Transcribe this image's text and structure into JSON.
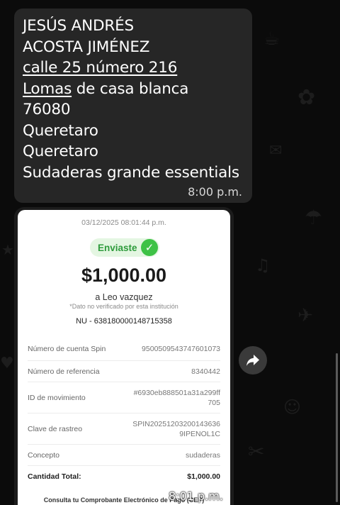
{
  "message": {
    "lines": [
      "JESÚS ANDRÉS",
      "ACOSTA JIMÉNEZ",
      "calle 25 número 216",
      "Lomas",
      " de casa blanca",
      "76080",
      "Queretaro",
      "Queretaro",
      "Sudaderas grande essentials"
    ],
    "time": "8:00 p.m."
  },
  "receipt": {
    "datetime": "03/12/2025 08:01:44 p.m.",
    "status": "Enviaste",
    "amount": "$1,000.00",
    "recipient": "a Leo vazquez",
    "unverified_note": "*Dato no verificado por esta institución",
    "account": "NU - 638180000148715358",
    "rows": [
      {
        "label": "Número de cuenta Spin",
        "value": "9500509543747601073"
      },
      {
        "label": "Número de referencia",
        "value": "8340442"
      },
      {
        "label": "ID de movimiento",
        "value1": "#6930eb888501a31a299ff",
        "value2": "705"
      },
      {
        "label": "Clave de rastreo",
        "value1": "SPIN20251203200143636",
        "value2": "9IPENOL1C"
      },
      {
        "label": "Concepto",
        "value": "sudaderas"
      },
      {
        "label": "Cantidad Total:",
        "value": "$1,000.00"
      }
    ],
    "footer": "Consulta tu Comprobante Electrónico de Pago (CEP)",
    "time": "8:01 p.m."
  },
  "icons": {
    "check": "check-circle-icon",
    "forward": "forward-arrow-icon"
  },
  "colors": {
    "background": "#0b0b0b",
    "bubble": "#262626",
    "success_green": "#3ec246",
    "badge_bg": "#e4f6e2"
  }
}
